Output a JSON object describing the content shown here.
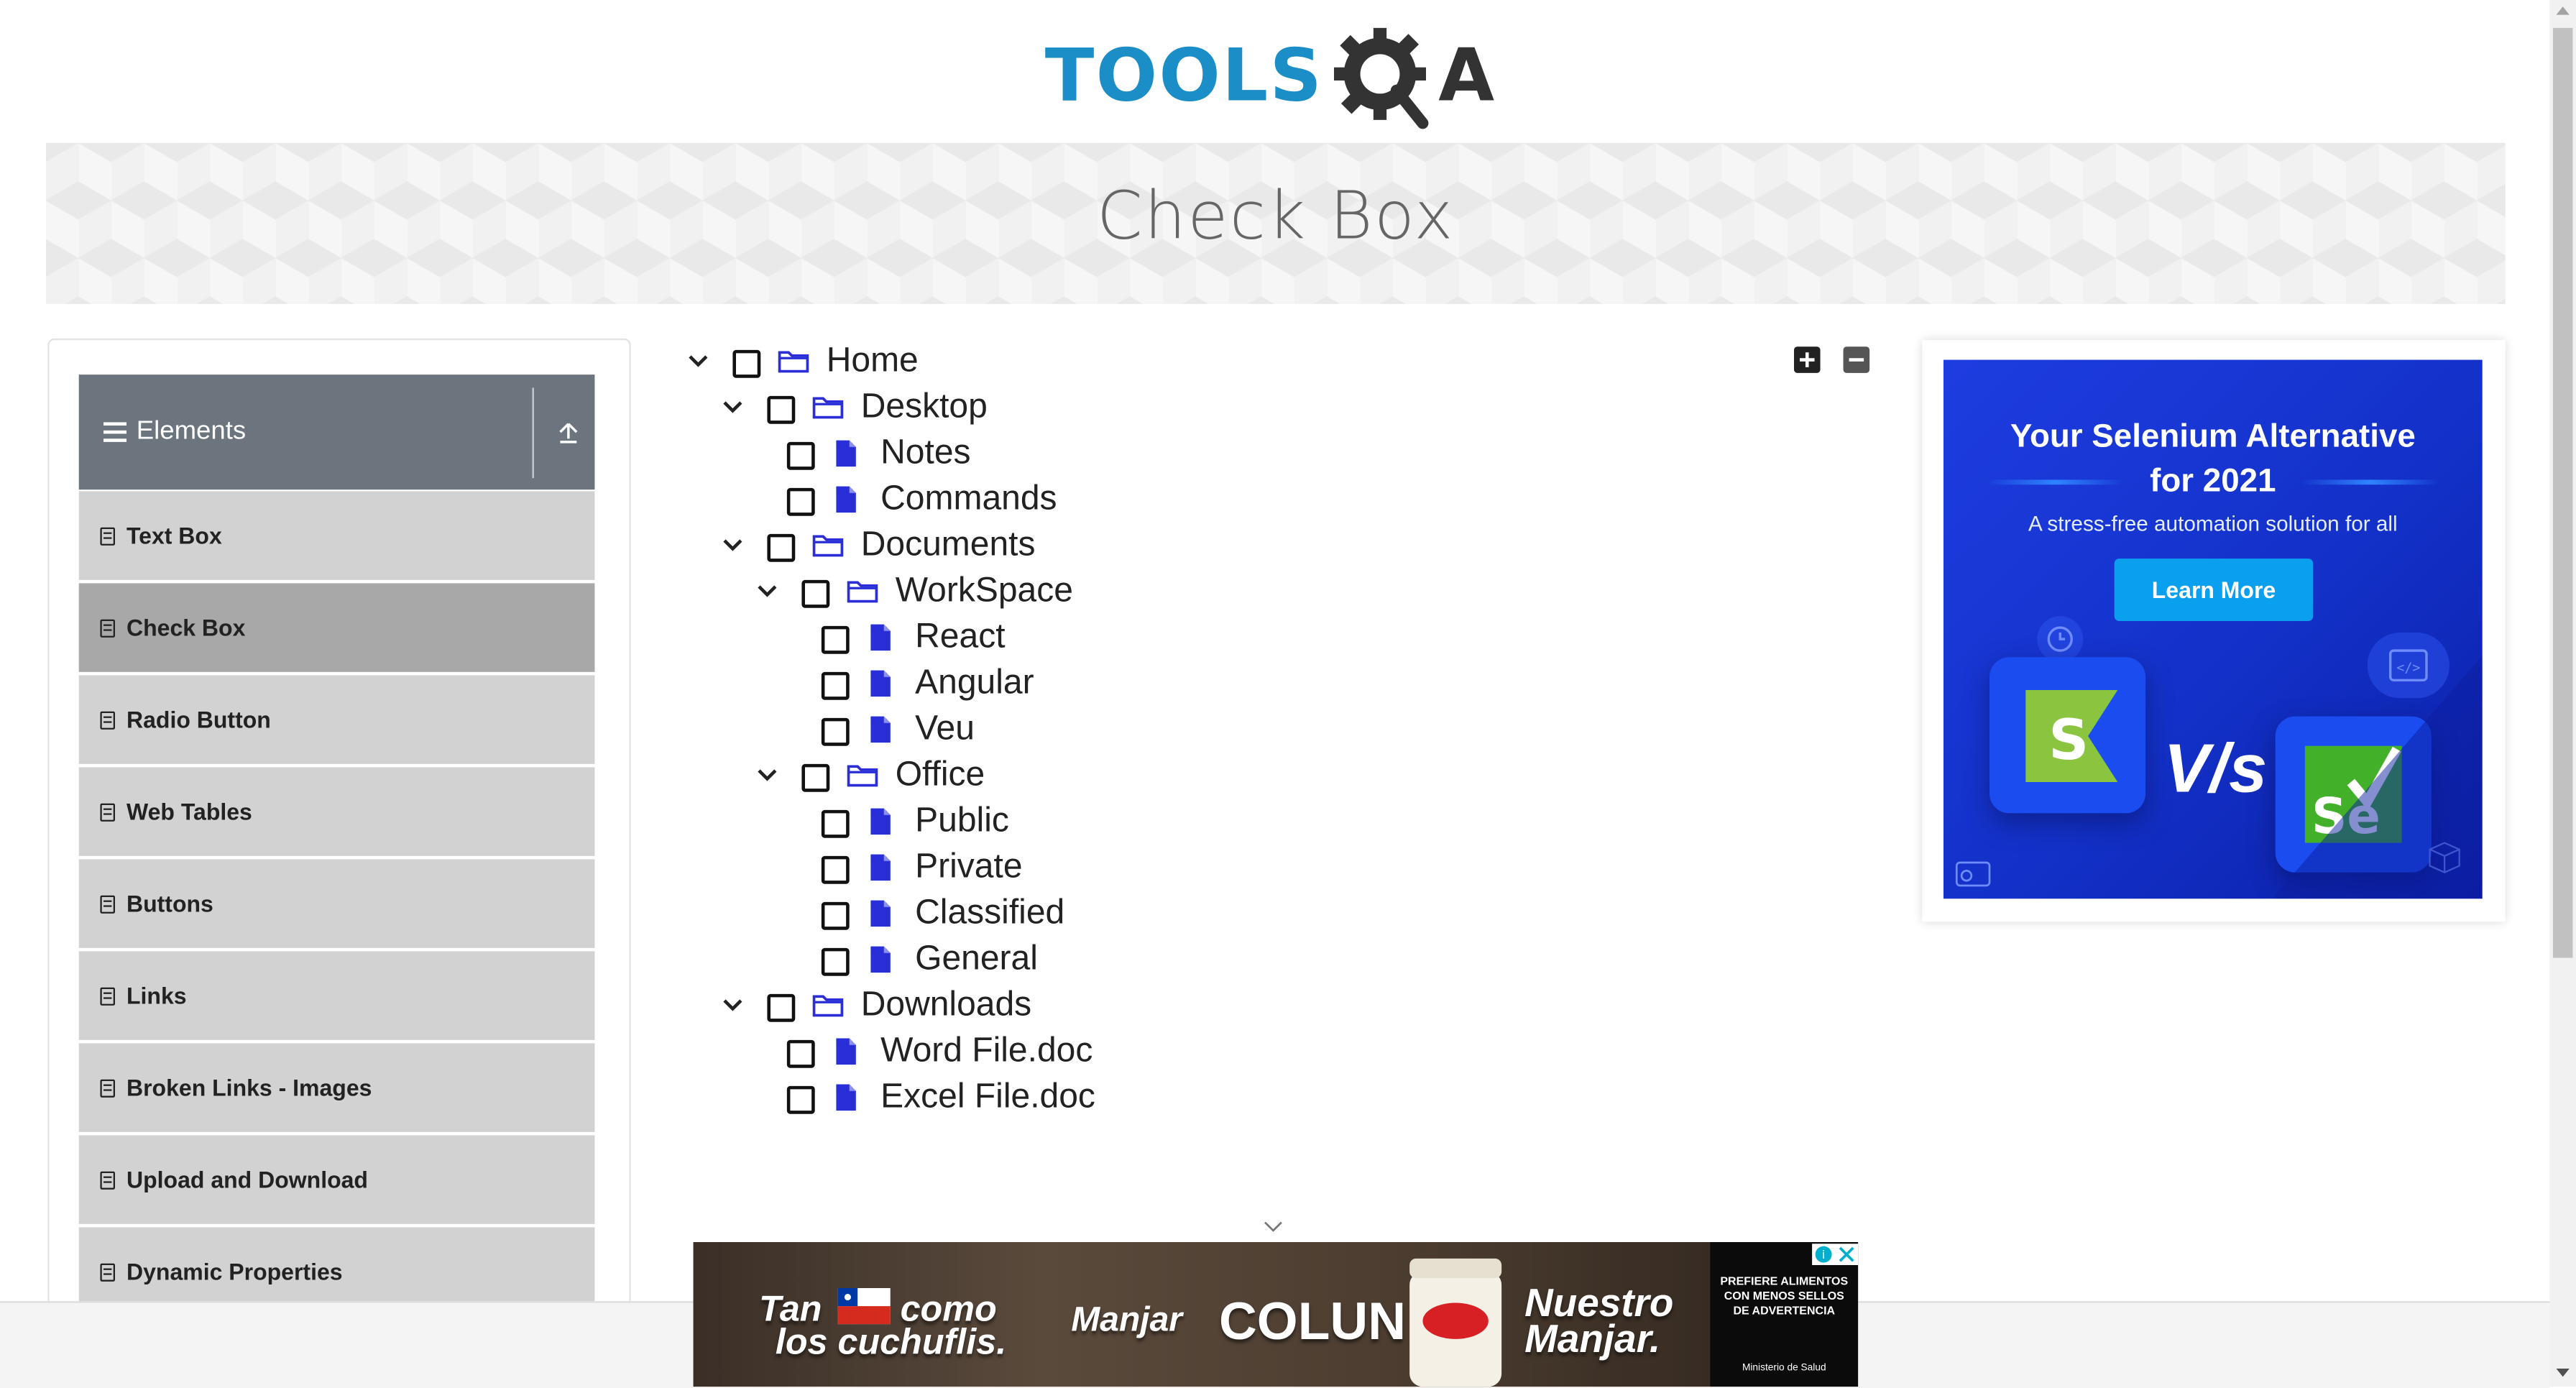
{
  "header": {
    "logo_text": "TOOLS",
    "logo_qa": "A"
  },
  "banner": {
    "title": "Check Box"
  },
  "sidebar": {
    "group_title": "Elements",
    "items": [
      {
        "label": "Text Box"
      },
      {
        "label": "Check Box",
        "active": true
      },
      {
        "label": "Radio Button"
      },
      {
        "label": "Web Tables"
      },
      {
        "label": "Buttons"
      },
      {
        "label": "Links"
      },
      {
        "label": "Broken Links - Images"
      },
      {
        "label": "Upload and Download"
      },
      {
        "label": "Dynamic Properties"
      }
    ]
  },
  "tree": {
    "nodes": [
      {
        "label": "Home",
        "type": "folder",
        "expanded": true,
        "checked": false
      },
      {
        "label": "Desktop",
        "type": "folder",
        "expanded": true,
        "checked": false
      },
      {
        "label": "Notes",
        "type": "file",
        "checked": false
      },
      {
        "label": "Commands",
        "type": "file",
        "checked": false
      },
      {
        "label": "Documents",
        "type": "folder",
        "expanded": true,
        "checked": false
      },
      {
        "label": "WorkSpace",
        "type": "folder",
        "expanded": true,
        "checked": false
      },
      {
        "label": "React",
        "type": "file",
        "checked": false
      },
      {
        "label": "Angular",
        "type": "file",
        "checked": false
      },
      {
        "label": "Veu",
        "type": "file",
        "checked": false
      },
      {
        "label": "Office",
        "type": "folder",
        "expanded": true,
        "checked": false
      },
      {
        "label": "Public",
        "type": "file",
        "checked": false
      },
      {
        "label": "Private",
        "type": "file",
        "checked": false
      },
      {
        "label": "Classified",
        "type": "file",
        "checked": false
      },
      {
        "label": "General",
        "type": "file",
        "checked": false
      },
      {
        "label": "Downloads",
        "type": "folder",
        "expanded": true,
        "checked": false
      },
      {
        "label": "Word File.doc",
        "type": "file",
        "checked": false
      },
      {
        "label": "Excel File.doc",
        "type": "file",
        "checked": false
      }
    ],
    "expand_all_icon": "plus-square-icon",
    "collapse_all_icon": "minus-square-icon"
  },
  "side_ad": {
    "title_line1": "Your Selenium Alternative",
    "title_line2": "for 2021",
    "subtitle": "A stress-free automation solution for all",
    "button": "Learn More",
    "vs": "V/s",
    "left_logo": "S",
    "right_logo": "Se"
  },
  "bottom_ad": {
    "text1_a": "Tan",
    "text1_b": "como",
    "text1_c": "los cuchuflis.",
    "text2": "Manjar",
    "brand": "COLUN",
    "text3_a": "Nuestro",
    "text3_b": "Manjar.",
    "warning": "PREFIERE ALIMENTOS CON MENOS SELLOS DE ADVERTENCIA",
    "ministry": "Ministerio de Salud"
  },
  "colors": {
    "accent_blue": "#1b8dc7",
    "sidebar_header": "#6c757d",
    "menu_item": "#d2d2d2",
    "menu_item_active": "#a8a8a8",
    "file_icon": "#2a2ed6",
    "ad_blue": "#1331c8",
    "ad_button": "#0aa0ef"
  }
}
